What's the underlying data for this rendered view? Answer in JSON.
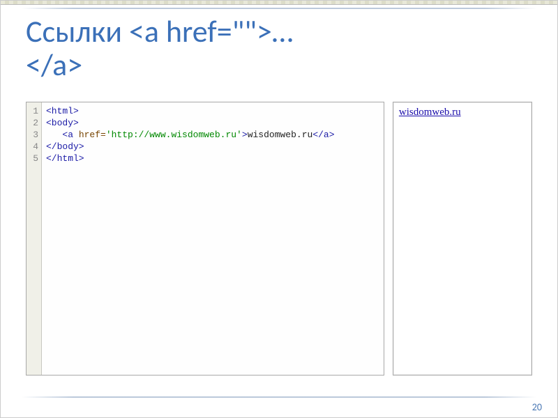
{
  "title": "Ссылки <a href=\"\">…\n</a>",
  "gutter": [
    "1",
    "2",
    "3",
    "4",
    "5"
  ],
  "code": {
    "l1_open": "<html>",
    "l2_open": "<body>",
    "l3_indent": "   ",
    "l3_openA": "<a ",
    "l3_attr": "href=",
    "l3_str": "'http://www.wisdomweb.ru'",
    "l3_closeA": ">",
    "l3_text": "wisdomweb.ru",
    "l3_endA": "</a>",
    "l4_close": "</body>",
    "l5_close": "</html>"
  },
  "preview": {
    "link_text": "wisdomweb.ru"
  },
  "slide_number": "20"
}
